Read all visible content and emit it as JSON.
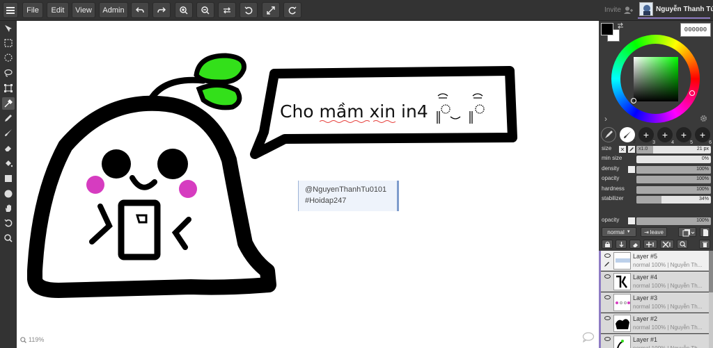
{
  "menu": {
    "file": "File",
    "edit": "Edit",
    "view": "View",
    "admin": "Admin"
  },
  "toolbar_icons": [
    "undo-icon",
    "redo-icon",
    "zoom-in-icon",
    "zoom-out-icon",
    "swap-icon",
    "rotate-left-icon",
    "fullscreen-icon",
    "rotate-right-icon"
  ],
  "user": {
    "invite": "Invite",
    "name": "Nguyễn Thanh Tú"
  },
  "canvas": {
    "speech_text": "Cho mầm xin in4",
    "note_line1": "@NguyenThanhTu0101",
    "note_line2": "#Hoidap247",
    "zoom": "119%"
  },
  "colors": {
    "primary": "#000000",
    "secondary": "#ffffff",
    "hex_value": "000000",
    "accent": "#8e7cc3"
  },
  "brush": {
    "brush_numbers": [
      "2",
      "3",
      "4",
      "5",
      "6"
    ],
    "size_label": "size",
    "size_multiplier": "x1.0",
    "size_value": "21 px",
    "size_fraction": 0.22,
    "sliders": [
      {
        "label": "min size",
        "value": "0%",
        "fraction": 0
      },
      {
        "label": "density",
        "value": "100%",
        "fraction": 1
      },
      {
        "label": "opacity",
        "value": "100%",
        "fraction": 1
      },
      {
        "label": "hardness",
        "value": "100%",
        "fraction": 1
      },
      {
        "label": "stabilizer",
        "value": "34%",
        "fraction": 0.34
      }
    ]
  },
  "layer_panel": {
    "opacity_label": "opacity",
    "opacity_value": "100%",
    "blend_mode": "normal",
    "leave_label": "leave",
    "layers": [
      {
        "name": "Layer #5",
        "meta": "normal 100% | Nguyễn Th...",
        "active": true
      },
      {
        "name": "Layer #4",
        "meta": "normal 100% | Nguyễn Th...",
        "active": false
      },
      {
        "name": "Layer #3",
        "meta": "normal 100% | Nguyễn Th...",
        "active": false
      },
      {
        "name": "Layer #2",
        "meta": "normal 100% | Nguyễn Th...",
        "active": false
      },
      {
        "name": "Layer #1",
        "meta": "normal 100% | Nguyễn Th...",
        "active": false
      }
    ]
  }
}
